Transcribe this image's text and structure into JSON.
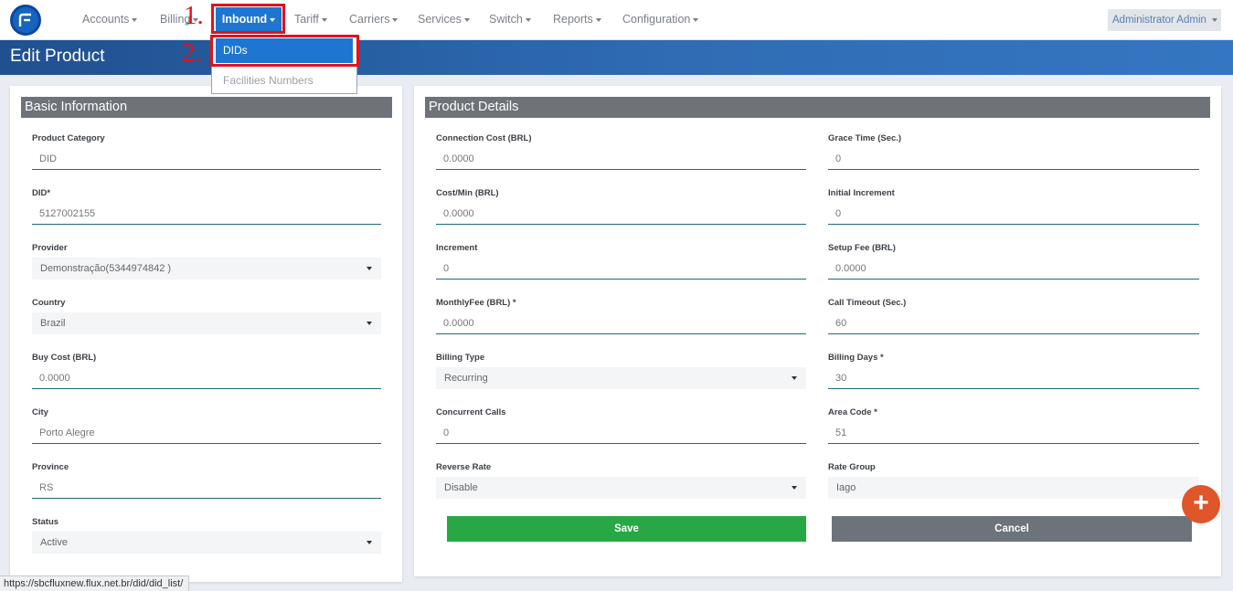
{
  "nav": {
    "items": [
      {
        "label": "Accounts"
      },
      {
        "label": "Billing"
      },
      {
        "label": "Inbound"
      },
      {
        "label": "Tariff"
      },
      {
        "label": "Carriers"
      },
      {
        "label": "Services"
      },
      {
        "label": "Switch"
      },
      {
        "label": "Reports"
      },
      {
        "label": "Configuration"
      }
    ],
    "user": "Administrator Admin"
  },
  "annotations": {
    "step1": "1.",
    "step2": "2."
  },
  "dropdown": {
    "items": [
      {
        "label": "DIDs"
      },
      {
        "label": "Facilities Numbers"
      }
    ]
  },
  "page": {
    "title": "Edit Product"
  },
  "basic": {
    "title": "Basic Information",
    "fields": [
      {
        "label": "Product Category",
        "value": "DID"
      },
      {
        "label": "DID*",
        "value": "5127002155"
      },
      {
        "label": "Provider",
        "value": "Demonstração(5344974842 )"
      },
      {
        "label": "Country",
        "value": "Brazil"
      },
      {
        "label": "Buy Cost (BRL)",
        "value": "0.0000"
      },
      {
        "label": "City",
        "value": "Porto Alegre"
      },
      {
        "label": "Province",
        "value": "RS"
      },
      {
        "label": "Status",
        "value": "Active"
      }
    ]
  },
  "details": {
    "title": "Product Details",
    "left": [
      {
        "label": "Connection Cost (BRL)",
        "value": "0.0000"
      },
      {
        "label": "Cost/Min (BRL)",
        "value": "0.0000"
      },
      {
        "label": "Increment",
        "value": "0"
      },
      {
        "label": "MonthlyFee (BRL) *",
        "value": "0.0000"
      },
      {
        "label": "Billing Type",
        "value": "Recurring"
      },
      {
        "label": "Concurrent Calls",
        "value": "0"
      },
      {
        "label": "Reverse Rate",
        "value": "Disable"
      }
    ],
    "right": [
      {
        "label": "Grace Time (Sec.)",
        "value": "0"
      },
      {
        "label": "Initial Increment",
        "value": "0"
      },
      {
        "label": "Setup Fee (BRL)",
        "value": "0.0000"
      },
      {
        "label": "Call Timeout (Sec.)",
        "value": "60"
      },
      {
        "label": "Billing Days *",
        "value": "30"
      },
      {
        "label": "Area Code *",
        "value": "51"
      },
      {
        "label": "Rate Group",
        "value": "Iago"
      }
    ],
    "save_label": "Save",
    "cancel_label": "Cancel"
  },
  "fab": {
    "label": "+"
  },
  "status_url": "https://sbcfluxnew.flux.net.br/did/did_list/",
  "colors": {
    "accent": "#1e76d2",
    "save": "#28a745",
    "cancel": "#6c737a",
    "fab": "#e0552a",
    "annotation": "#e3121b"
  }
}
